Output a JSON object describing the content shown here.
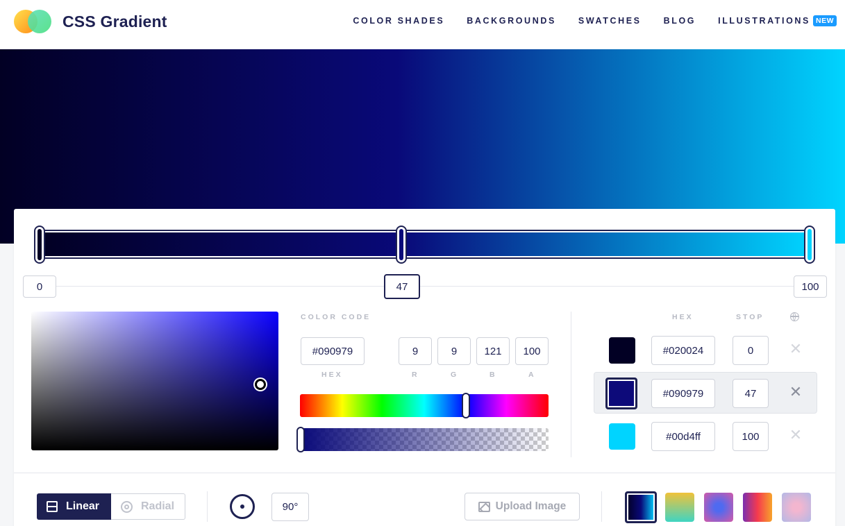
{
  "nav": {
    "logo_text": "CSS Gradient",
    "links": [
      "COLOR SHADES",
      "BACKGROUNDS",
      "SWATCHES",
      "BLOG",
      "ILLUSTRATIONS"
    ],
    "new_badge": "NEW"
  },
  "colors": {
    "stop0": "#020024",
    "stop1": "#090979",
    "stop2": "#00d4ff",
    "brand": "#1e2152",
    "badge": "#1a9bff"
  },
  "gradient_bar": {
    "stops": [
      0,
      47,
      100
    ],
    "active_stop": 47
  },
  "picker": {
    "label": "COLOR CODE",
    "hex": "#090979",
    "r": "9",
    "g": "9",
    "b": "121",
    "a": "100",
    "hex_label": "HEX",
    "r_label": "R",
    "g_label": "G",
    "b_label": "B",
    "a_label": "A"
  },
  "stop_list": {
    "hex_header": "HEX",
    "stop_header": "STOP",
    "globe_icon": "globe-icon",
    "rows": [
      {
        "hex": "#020024",
        "stop": "0",
        "color": "#020024"
      },
      {
        "hex": "#090979",
        "stop": "47",
        "color": "#0d0a7a"
      },
      {
        "hex": "#00d4ff",
        "stop": "100",
        "color": "#00d4ff"
      }
    ],
    "delete_glyph": "✕"
  },
  "toolbar": {
    "linear_label": "Linear",
    "radial_label": "Radial",
    "angle": "90°",
    "upload_label": "Upload Image",
    "presets": [
      "preset-1",
      "preset-2",
      "preset-3",
      "preset-4",
      "preset-5"
    ]
  }
}
